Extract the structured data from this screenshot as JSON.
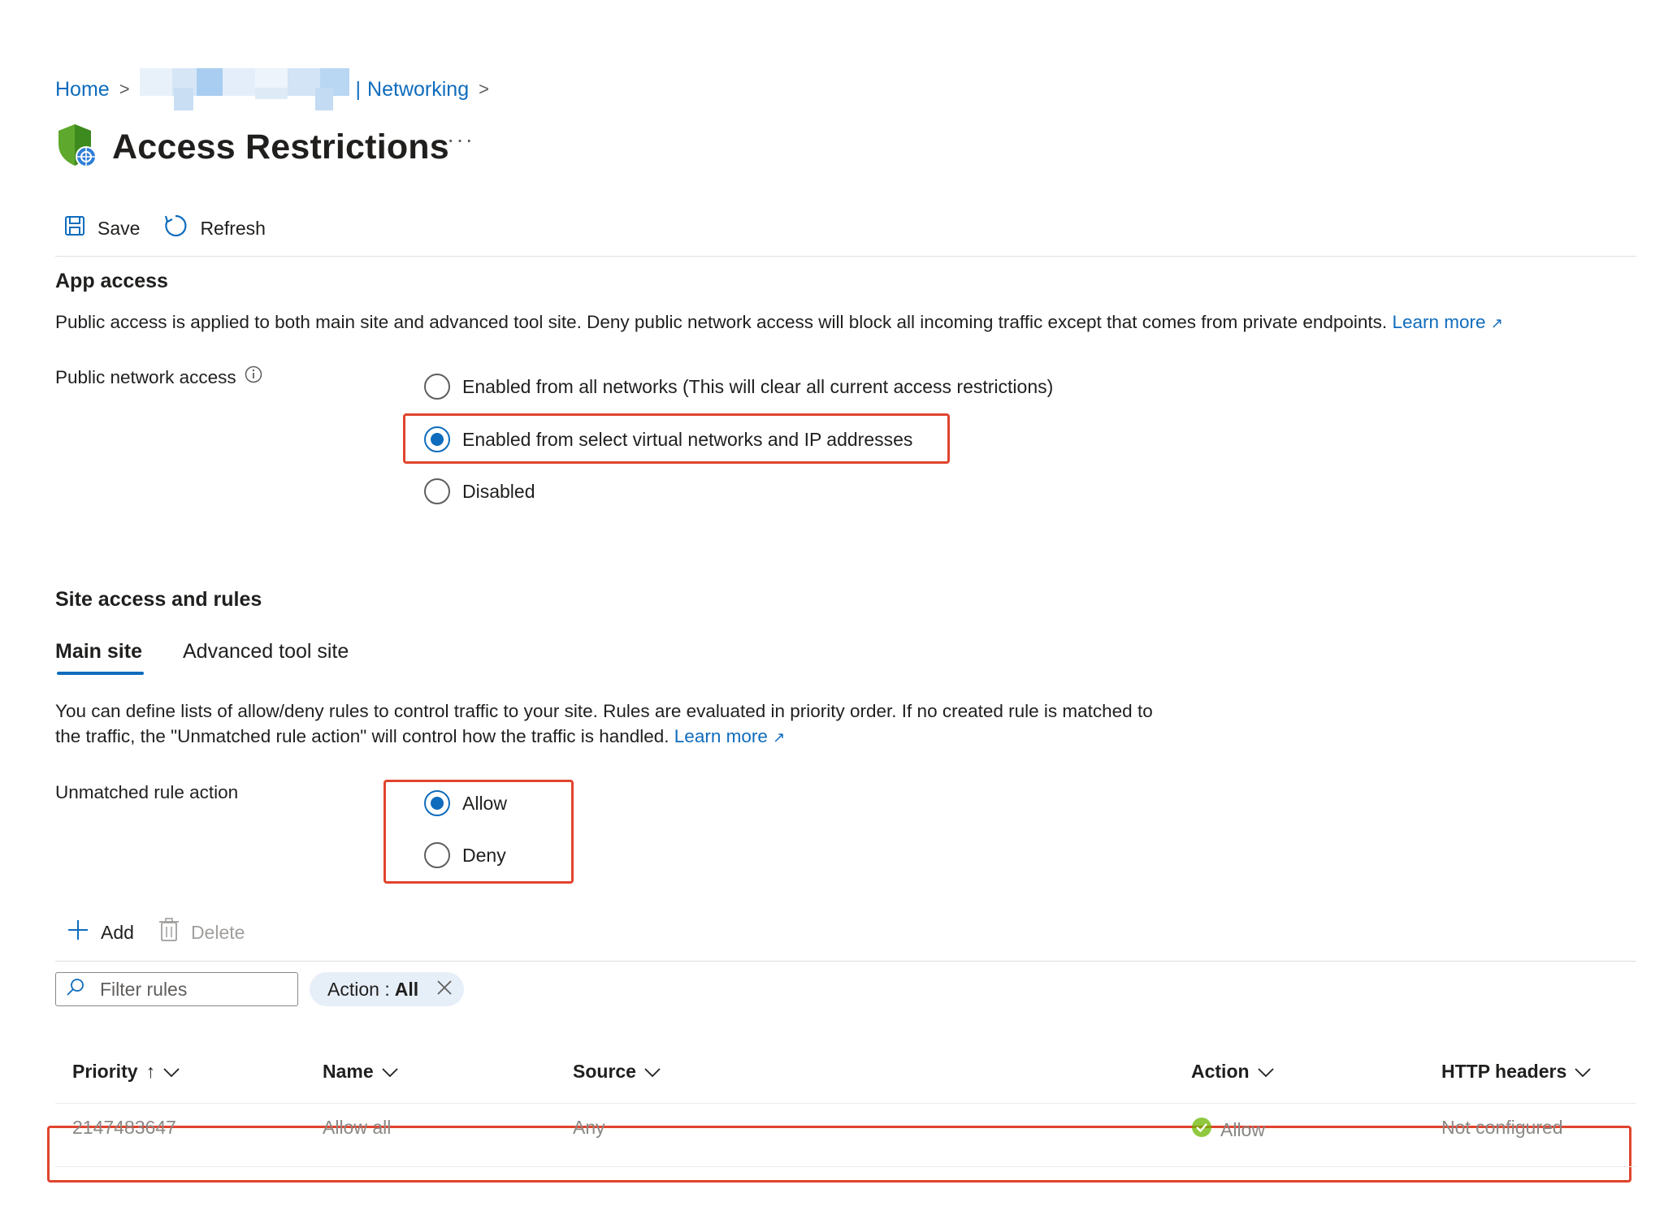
{
  "breadcrumb": {
    "home": "Home",
    "networking": "Networking"
  },
  "page": {
    "title": "Access Restrictions",
    "more": "···"
  },
  "toolbar": {
    "save": "Save",
    "refresh": "Refresh"
  },
  "app_access": {
    "heading": "App access",
    "description": "Public access is applied to both main site and advanced tool site. Deny public network access will block all incoming traffic except that comes from private endpoints.",
    "learn_more": "Learn more",
    "public_network_access_label": "Public network access",
    "options": [
      {
        "label": "Enabled from all networks (This will clear all current access restrictions)",
        "checked": false
      },
      {
        "label": "Enabled from select virtual networks and IP addresses",
        "checked": true
      },
      {
        "label": "Disabled",
        "checked": false
      }
    ]
  },
  "site_access": {
    "heading": "Site access and rules",
    "tabs": [
      {
        "label": "Main site",
        "active": true
      },
      {
        "label": "Advanced tool site",
        "active": false
      }
    ],
    "description_line1": "You can define lists of allow/deny rules to control traffic to your site. Rules are evaluated in priority order. If no created rule is matched to",
    "description_line2": "the traffic, the \"Unmatched rule action\" will control how the traffic is handled.",
    "learn_more": "Learn more",
    "unmatched_label": "Unmatched rule action",
    "unmatched_options": [
      {
        "label": "Allow",
        "checked": true
      },
      {
        "label": "Deny",
        "checked": false
      }
    ]
  },
  "rules_toolbar": {
    "add": "Add",
    "delete": "Delete"
  },
  "filter": {
    "placeholder": "Filter rules",
    "pill_key": "Action :",
    "pill_value": "All"
  },
  "table": {
    "columns": [
      "Priority",
      "Name",
      "Source",
      "Action",
      "HTTP headers"
    ],
    "rows": [
      {
        "priority": "2147483647",
        "name": "Allow all",
        "source": "Any",
        "action": "Allow",
        "http_headers": "Not configured"
      }
    ]
  },
  "colors": {
    "accent": "#0f6cbd",
    "highlight_box": "#e0442e",
    "success": "#6bb700"
  }
}
